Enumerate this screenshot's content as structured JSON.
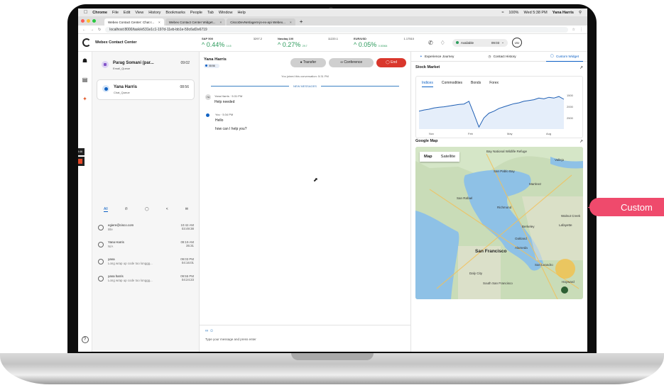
{
  "menubar": {
    "app": "Chrome",
    "items": [
      "File",
      "Edit",
      "View",
      "History",
      "Bookmarks",
      "People",
      "Tab",
      "Window",
      "Help"
    ],
    "battery": "100%",
    "clock": "Wed 5:38 PM",
    "user": "Yana Harris"
  },
  "browser": {
    "tabs": [
      {
        "label": "Webex Contact Center: Chat r..."
      },
      {
        "label": "Webex Contact Center Widget..."
      },
      {
        "label": "CiscoDevNet/agent-js-ex-api Webex..."
      }
    ],
    "new_tab": "+",
    "url": "localhost:8000/task/e531e1c1-197d-11eb-bb1e-59c6af2e6719"
  },
  "app": {
    "title": "Webex Contact Center",
    "tickers": [
      {
        "symbol": "S&P 500",
        "price": "3297.2",
        "change": "0.44%",
        "points": "14.5"
      },
      {
        "symbol": "Nasdaq 100",
        "price": "11220.1",
        "change": "0.27%",
        "points": "29.7"
      },
      {
        "symbol": "EUR/USD",
        "price": "1.17510",
        "change": "0.05%",
        "points": "0.00064"
      }
    ],
    "status": {
      "label": "Available",
      "timer": "09:03"
    },
    "avatar_initials": "UU"
  },
  "rail": {
    "timer_badge": "3:46"
  },
  "tasks": [
    {
      "name": "Parag Somani (par...",
      "queue": "Email_Queue",
      "time": "09:02"
    },
    {
      "name": "Yana Harris",
      "queue": "Chat_Queue",
      "time": "08:56"
    }
  ],
  "filters": [
    "All"
  ],
  "history": [
    {
      "from": "egiere@cisco.com",
      "sub": "title",
      "time": "10:42 AM",
      "duration": "03:49:38"
    },
    {
      "from": "Yana Harris",
      "sub": "N/A",
      "time": "09:19 AM",
      "duration": "35:31"
    },
    {
      "from": "yana",
      "sub": "Long wrap up code too longgg...",
      "time": "09:03 PM",
      "duration": "04:16:01"
    },
    {
      "from": "yana harris",
      "sub": "Long wrap up code too longgg...",
      "time": "09:55 PM",
      "duration": "04:24:23"
    }
  ],
  "chat": {
    "customer": "Yana Harris",
    "elapsed": "08:56",
    "transfer": "Transfer",
    "conference": "Conference",
    "end": "End",
    "joined": "You joined this conversation: 5:31 PM",
    "new_messages": "NEW MESSAGES",
    "messages": [
      {
        "initials": "YH",
        "sender": "Yana Harris",
        "time": "5:31 PM",
        "lines": [
          "Help needed"
        ]
      },
      {
        "initials": "",
        "sender": "You",
        "time": "5:34 PM",
        "lines": [
          "Hello",
          "how can I help you?"
        ]
      }
    ],
    "composer_placeholder": "Type your message and press enter"
  },
  "panel": {
    "tabs": [
      "Experience Journey",
      "Contact History",
      "Custom Widget"
    ],
    "stock_title": "Stock Market",
    "stock_tabs": [
      "Indices",
      "Commodities",
      "Bonds",
      "Forex"
    ],
    "map_title": "Google Map",
    "map_tabs": [
      "Map",
      "Satellite"
    ],
    "map_labels": [
      "Bay National Wildlife Refuge",
      "Vallejo",
      "San Pablo Bay",
      "San Rafael",
      "Richmond",
      "Berkeley",
      "Oakland",
      "Alameda",
      "San Francisco",
      "Daly City",
      "San Leandro",
      "South San Francisco",
      "Hayward",
      "Martinez",
      "Walnut Creek",
      "Lafayette"
    ]
  },
  "chart_data": {
    "type": "line",
    "x_tick_labels": [
      "Nov",
      "Feb",
      "May",
      "Aug"
    ],
    "y_tick_labels": [
      "1500",
      "2000",
      "2500"
    ],
    "series": [
      {
        "values": [
          0.55,
          0.52,
          0.5,
          0.47,
          0.45,
          0.44,
          0.42,
          0.4,
          0.38,
          0.37,
          0.3,
          0.62,
          0.95,
          0.72,
          0.6,
          0.55,
          0.48,
          0.44,
          0.4,
          0.36,
          0.34,
          0.3,
          0.28,
          0.26,
          0.22,
          0.24,
          0.2,
          0.22,
          0.18,
          0.25
        ]
      }
    ]
  },
  "callout": {
    "text": "Custom"
  }
}
